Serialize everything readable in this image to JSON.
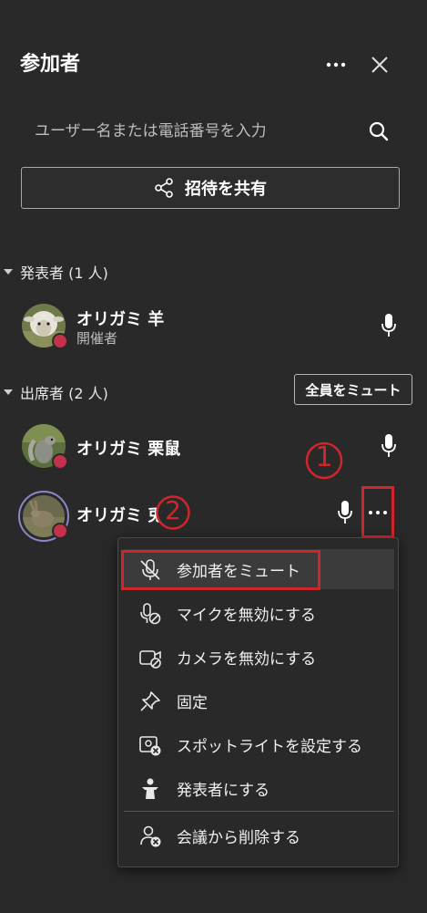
{
  "header": {
    "title": "参加者"
  },
  "search": {
    "placeholder": "ユーザー名または電話番号を入力"
  },
  "share": {
    "label": "招待を共有"
  },
  "presenters": {
    "header": "発表者 (1 人)",
    "people": [
      {
        "name": "オリガミ 羊",
        "role": "開催者"
      }
    ]
  },
  "attendees": {
    "header": "出席者 (2 人)",
    "mute_all_label": "全員をミュート",
    "people": [
      {
        "name": "オリガミ 栗鼠"
      },
      {
        "name": "オリガミ 兎"
      }
    ]
  },
  "annotations": {
    "step1": "1",
    "step2": "2"
  },
  "menu": {
    "items": [
      {
        "label": "参加者をミュート",
        "icon": "mic-off-icon"
      },
      {
        "label": "マイクを無効にする",
        "icon": "mic-disabled-icon"
      },
      {
        "label": "カメラを無効にする",
        "icon": "camera-disabled-icon"
      },
      {
        "label": "固定",
        "icon": "pin-icon"
      },
      {
        "label": "スポットライトを設定する",
        "icon": "spotlight-icon"
      },
      {
        "label": "発表者にする",
        "icon": "presenter-icon"
      },
      {
        "label": "会議から削除する",
        "icon": "remove-person-icon"
      }
    ]
  },
  "colors": {
    "background": "#292929",
    "annotation_red": "#d0262b",
    "status_dot": "#c4314b"
  }
}
